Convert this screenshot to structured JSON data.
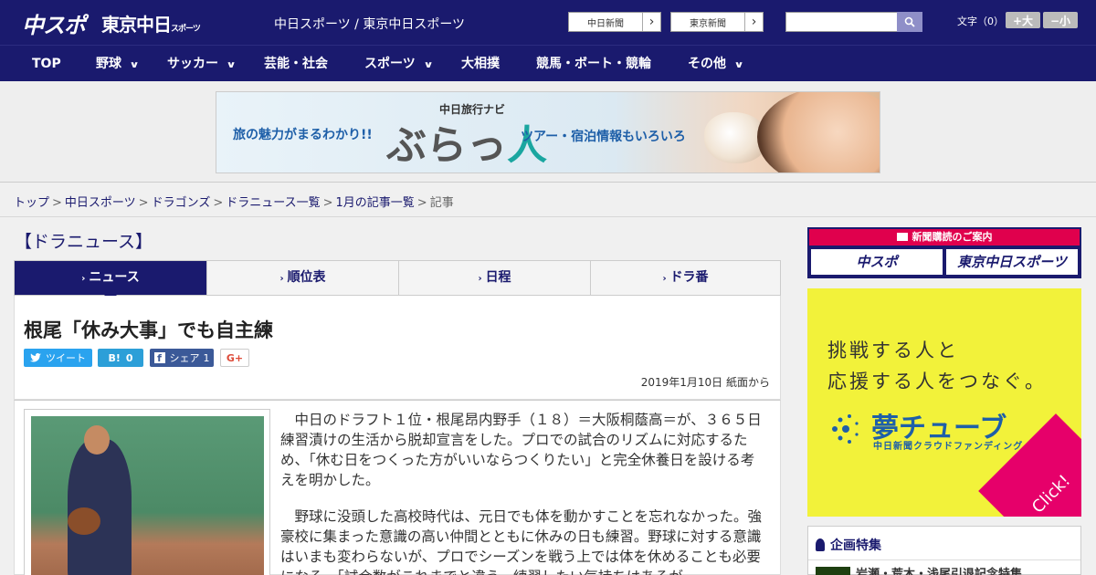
{
  "header": {
    "logo_chunichi": "中スポ",
    "logo_tokyo": "東京中日",
    "logo_tokyo_small": "スポーツ",
    "site_title": "中日スポーツ / 東京中日スポーツ",
    "newspaper_links": [
      "中日新聞",
      "東京新聞"
    ],
    "search_placeholder": "",
    "font_label": "文字（0）",
    "font_plus": "+大",
    "font_minus": "−小"
  },
  "nav": {
    "items": [
      {
        "label": "TOP",
        "has_menu": false
      },
      {
        "label": "野球",
        "has_menu": true
      },
      {
        "label": "サッカー",
        "has_menu": true
      },
      {
        "label": "芸能・社会",
        "has_menu": false
      },
      {
        "label": "スポーツ",
        "has_menu": true
      },
      {
        "label": "大相撲",
        "has_menu": false
      },
      {
        "label": "競馬・ボート・競輪",
        "has_menu": false
      },
      {
        "label": "その他",
        "has_menu": true
      }
    ]
  },
  "banner": {
    "text_left": "旅の魅力がまるわかり!!",
    "text_brand_small": "中日旅行ナビ",
    "text_brand_a": "ぶらっ",
    "text_brand_b": "人",
    "text_right": "ツアー・宿泊情報もいろいろ"
  },
  "breadcrumb": {
    "items": [
      "トップ",
      "中日スポーツ",
      "ドラゴンズ",
      "ドラニュース一覧",
      "1月の記事一覧"
    ],
    "current": "記事"
  },
  "section": {
    "heading": "【ドラニュース】"
  },
  "tabs": [
    "ニュース",
    "順位表",
    "日程",
    "ドラ番"
  ],
  "article": {
    "title": "根尾「休み大事」でも自主練",
    "share": {
      "tweet": "ツイート",
      "hatena_count": "0",
      "facebook": "シェア",
      "facebook_count": "1",
      "gplus": "G+"
    },
    "date": "2019年1月10日 紙面から",
    "paragraphs": [
      "中日のドラフト１位・根尾昂内野手（１８）＝大阪桐蔭高＝が、３６５日練習漬けの生活から脱却宣言をした。プロでの試合のリズムに対応するため、「休む日をつくった方がいいならつくりたい」と完全休養日を設ける考えを明かした。",
      "野球に没頭した高校時代は、元日でも体を動かすことを忘れなかった。強豪校に集まった意識の高い仲間とともに休みの日も練習。野球に対する意識はいまも変わらないが、プロでシーズンを戦う上では体を休めることも必要になる。「試合数がこれまでと違う。練習したい気持ちはあるが"
    ]
  },
  "sidebar": {
    "subscribe_head": "新聞購読のご案内",
    "subscribe_btn_1": "中スポ",
    "subscribe_btn_2": "東京中日スポーツ",
    "ad_line1": "挑戦する人と",
    "ad_line2": "応援する人をつなぐ。",
    "ad_logo": "夢チューブ",
    "ad_sub": "中日新聞クラウドファンディング",
    "ad_click": "Click!",
    "feature_heading": "企画特集",
    "feature_item": "岩瀬・荒木・浅尾引退記念特集"
  },
  "colors": {
    "brand_navy": "#1a1a6e",
    "accent_pink": "#e0004d",
    "ad_yellow": "#f2f23a",
    "twitter": "#2aa3ef",
    "facebook": "#3b5998"
  }
}
